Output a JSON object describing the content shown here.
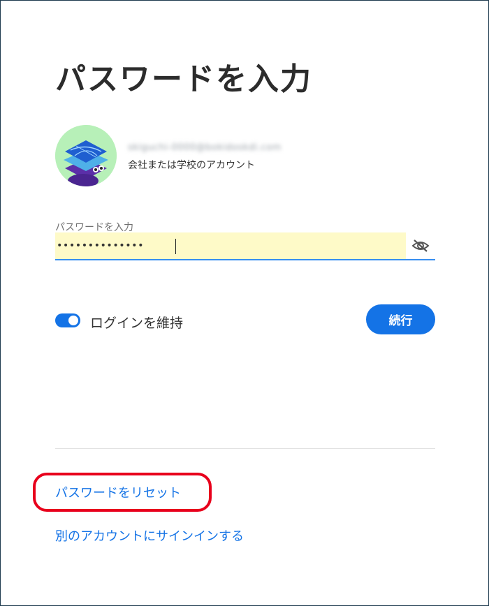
{
  "page": {
    "title": "パスワードを入力"
  },
  "account": {
    "email": "skiguchi-0000@bokidoskdi.com",
    "type_label": "会社または学校のアカウント"
  },
  "password": {
    "label": "パスワードを入力",
    "value": "••••••••••••••"
  },
  "keep_signed_in": {
    "label": "ログインを維持",
    "enabled": true
  },
  "buttons": {
    "continue_label": "続行"
  },
  "links": {
    "reset_password": "パスワードをリセット",
    "switch_account": "別のアカウントにサインインする"
  },
  "colors": {
    "accent": "#1473e6",
    "autofill_bg": "#fefac8",
    "highlight_ring": "#e8001c",
    "avatar_bg": "#b7f0b8"
  },
  "icons": {
    "avatar": "layered-stack-avatar",
    "password_toggle": "eye-slash-icon"
  }
}
